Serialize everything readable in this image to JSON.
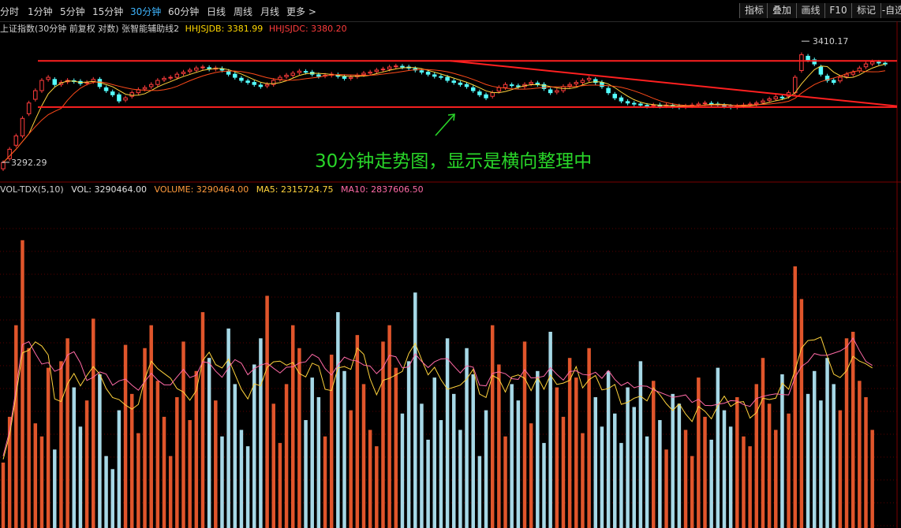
{
  "toolbar": {
    "timeframes": [
      "分时",
      "1分钟",
      "5分钟",
      "15分钟",
      "30分钟",
      "60分钟",
      "日线",
      "周线",
      "月线",
      "更多 >"
    ],
    "active": "30分钟",
    "right_buttons": [
      "指标",
      "叠加",
      "画线",
      "F10",
      "标记",
      "-自选"
    ]
  },
  "price_header": {
    "title": "上证指数(30分钟 前复权 对数) 张智能辅助线2",
    "hhjsjdb_label": "HHJSJDB: 3381.99",
    "hhjsjdc_label": "HHJSJDC: 3380.20"
  },
  "volume_header": {
    "title": "VOL-TDX(5,10)",
    "vol": "VOL: 3290464.00",
    "volume": "VOLUME: 3290464.00",
    "ma5": "MA5: 2315724.75",
    "ma10": "MA10: 2837606.50"
  },
  "annotation": "30分钟走势图，显示是横向整理中",
  "colors": {
    "up": "#ff3c3c",
    "down": "#54ffff",
    "vol_up": "#e0552b",
    "vol_down": "#a6d8e6",
    "ma_fast": "#ffffff",
    "ma_slow": "#ffd33c",
    "ma_orange": "#ff9a3c",
    "ma10_pink": "#ff6aa6",
    "trendline": "#ff2020",
    "annotation": "#29d629"
  },
  "chart_data": {
    "type": "candlestick",
    "price_labels": {
      "high": "3410.17",
      "low": "3292.29"
    },
    "price_range": [
      3280,
      3418
    ],
    "trendlines": [
      {
        "name": "resistance",
        "from_bar": 0,
        "to_bar": 1,
        "price_from": 3391.0,
        "price_to": 3391.0
      },
      {
        "name": "support",
        "from_bar": 0,
        "to_bar": 1,
        "price_from": 3346.0,
        "price_to": 3346.0
      },
      {
        "name": "falling",
        "from_bar": 0.48,
        "to_bar": 1,
        "price_from": 3391.0,
        "price_to": 3347.0
      }
    ],
    "closes": [
      3292,
      3305,
      3318,
      3335,
      3350,
      3362,
      3372,
      3375,
      3368,
      3370,
      3372,
      3371,
      3369,
      3370,
      3373,
      3366,
      3362,
      3358,
      3352,
      3355,
      3360,
      3363,
      3365,
      3368,
      3372,
      3374,
      3375,
      3378,
      3380,
      3382,
      3384,
      3385,
      3383,
      3384,
      3382,
      3378,
      3375,
      3372,
      3370,
      3368,
      3366,
      3368,
      3372,
      3375,
      3377,
      3379,
      3381,
      3380,
      3378,
      3376,
      3377,
      3378,
      3376,
      3374,
      3375,
      3377,
      3379,
      3380,
      3382,
      3383,
      3385,
      3386,
      3385,
      3384,
      3382,
      3380,
      3378,
      3376,
      3375,
      3372,
      3370,
      3368,
      3366,
      3362,
      3358,
      3355,
      3360,
      3365,
      3368,
      3367,
      3366,
      3368,
      3370,
      3368,
      3364,
      3360,
      3362,
      3366,
      3368,
      3370,
      3372,
      3374,
      3370,
      3366,
      3360,
      3355,
      3352,
      3350,
      3349,
      3348,
      3347,
      3348,
      3347,
      3348,
      3347,
      3346,
      3347,
      3348,
      3349,
      3350,
      3349,
      3348,
      3347,
      3346,
      3347,
      3348,
      3349,
      3350,
      3352,
      3354,
      3356,
      3355,
      3360,
      3375,
      3397,
      3392,
      3388,
      3378,
      3372,
      3370,
      3375,
      3378,
      3380,
      3384,
      3388,
      3390,
      3389,
      3388
    ],
    "volumes": [
      20,
      34,
      62,
      88,
      55,
      32,
      28,
      49,
      24,
      51,
      58,
      43,
      31,
      39,
      64,
      47,
      22,
      18,
      36,
      56,
      41,
      29,
      55,
      62,
      45,
      34,
      22,
      40,
      57,
      33,
      48,
      66,
      52,
      39,
      28,
      61,
      44,
      30,
      25,
      50,
      58,
      71,
      38,
      26,
      44,
      62,
      55,
      33,
      46,
      40,
      28,
      53,
      66,
      48,
      36,
      59,
      44,
      30,
      25,
      57,
      62,
      49,
      35,
      51,
      72,
      38,
      27,
      46,
      33,
      58,
      41,
      30,
      55,
      47,
      22,
      36,
      62,
      50,
      28,
      44,
      39,
      57,
      32,
      48,
      26,
      60,
      43,
      34,
      52,
      46,
      29,
      55,
      40,
      31,
      48,
      35,
      26,
      43,
      37,
      51,
      28,
      45,
      33,
      24,
      41,
      38,
      30,
      22,
      46,
      34,
      27,
      49,
      36,
      31,
      40,
      28,
      25,
      44,
      52,
      38,
      30,
      47,
      35,
      80,
      70,
      41,
      48,
      39,
      52,
      44,
      36,
      58,
      60,
      45,
      40,
      30
    ]
  }
}
